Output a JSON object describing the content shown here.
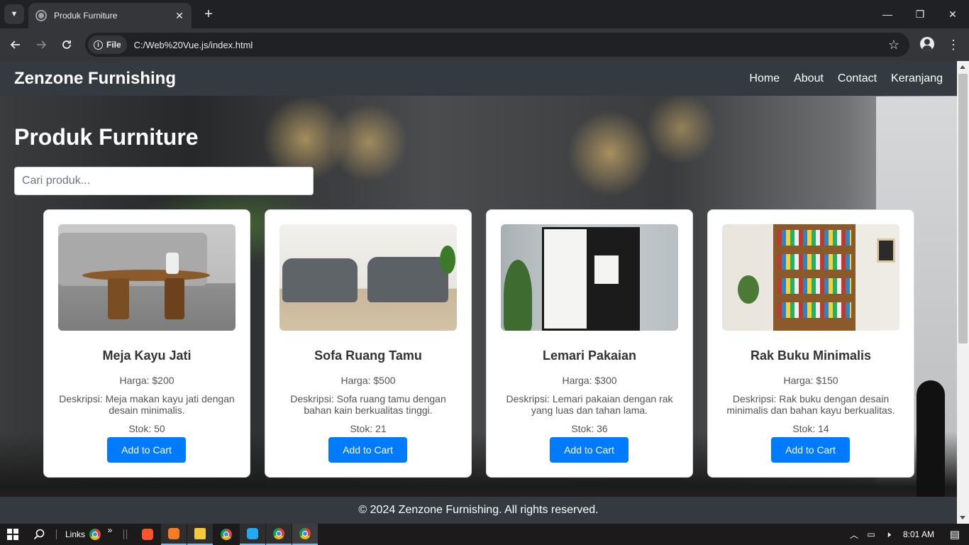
{
  "browser": {
    "tab_title": "Produk Furniture",
    "tab_list_icon": "chevron-down-icon",
    "new_tab_symbol": "+",
    "close_symbol": "✕",
    "address_chip": "File",
    "url": "C:/Web%20Vue.js/index.html",
    "window_controls": {
      "minimize": "—",
      "restore": "❐",
      "close": "✕"
    }
  },
  "navbar": {
    "brand": "Zenzone Furnishing",
    "links": [
      "Home",
      "About",
      "Contact",
      "Keranjang"
    ],
    "background": "#343a40"
  },
  "page": {
    "title": "Produk Furniture",
    "search_placeholder": "Cari produk...",
    "search_value": ""
  },
  "products": [
    {
      "name": "Meja Kayu Jati",
      "price": "Harga: $200",
      "description": "Deskripsi: Meja makan kayu jati dengan desain minimalis.",
      "stock": "Stok: 50",
      "button": "Add to Cart",
      "image_icon": "coffee-table-image"
    },
    {
      "name": "Sofa Ruang Tamu",
      "price": "Harga: $500",
      "description": "Deskripsi: Sofa ruang tamu dengan bahan kain berkualitas tinggi.",
      "stock": "Stok: 21",
      "button": "Add to Cart",
      "image_icon": "sofa-image"
    },
    {
      "name": "Lemari Pakaian",
      "price": "Harga: $300",
      "description": "Deskripsi: Lemari pakaian dengan rak yang luas dan tahan lama.",
      "stock": "Stok: 36",
      "button": "Add to Cart",
      "image_icon": "wardrobe-image"
    },
    {
      "name": "Rak Buku Minimalis",
      "price": "Harga: $150",
      "description": "Deskripsi: Rak buku dengan desain minimalis dan bahan kayu berkualitas.",
      "stock": "Stok: 14",
      "button": "Add to Cart",
      "image_icon": "bookshelf-image"
    }
  ],
  "footer": {
    "text": "© 2024 Zenzone Furnishing. All rights reserved."
  },
  "taskbar": {
    "links_label": "Links",
    "overflow": "»",
    "time": "8:01 AM"
  },
  "colors": {
    "primary_button": "#007bff",
    "card_background": "#ffffff"
  }
}
